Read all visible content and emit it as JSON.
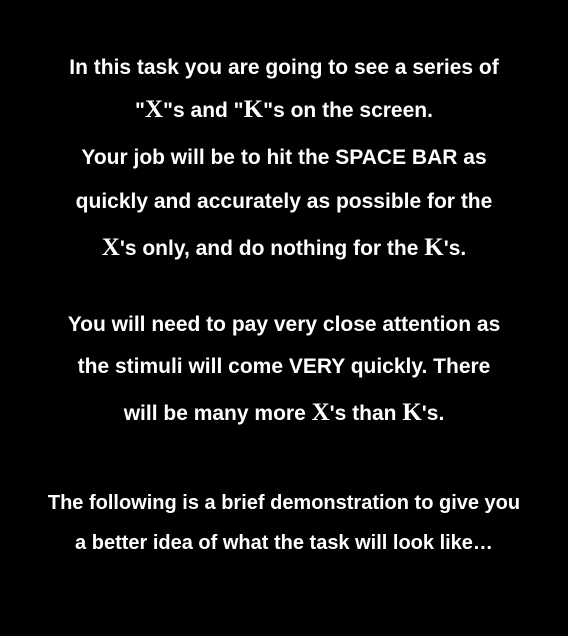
{
  "instructions": {
    "p1": {
      "l1": "In this task you are going to see a series of",
      "l2_pre": "\"",
      "l2_x": "X",
      "l2_mid": "\"s and \"",
      "l2_k": "K",
      "l2_post": "\"s on the screen.",
      "l3": "Your job will be to hit the SPACE BAR as",
      "l4": "quickly and accurately as possible for the",
      "l5_x": "X",
      "l5_mid": "'s only, and do nothing for the ",
      "l5_k": "K",
      "l5_post": "'s."
    },
    "p2": {
      "l1": "You will need to pay very close attention as",
      "l2": "the stimuli will come VERY quickly. There",
      "l3_pre": "will be many more ",
      "l3_x": "X",
      "l3_mid": "'s than ",
      "l3_k": "K",
      "l3_post": "'s."
    },
    "p3": {
      "l1": "The following is a brief demonstration to give you",
      "l2": "a better idea of what the task will look like…"
    }
  }
}
